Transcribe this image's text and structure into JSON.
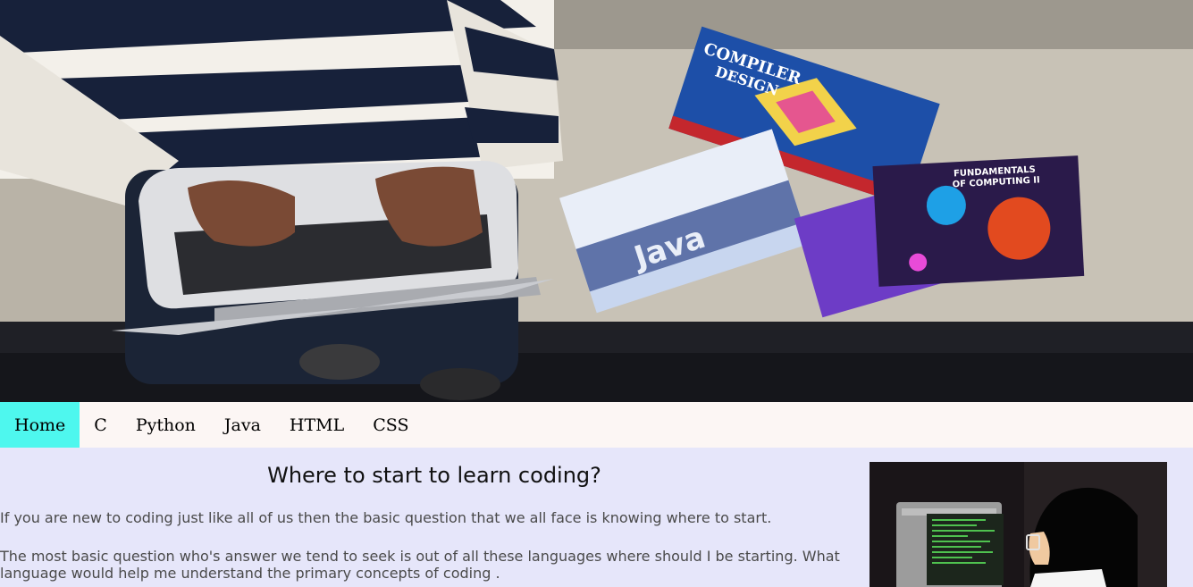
{
  "hero": {
    "image_alt": "person-coding-laptop-with-books",
    "book_labels": [
      "COMPILER DESIGN",
      "Java",
      "FUNDAMENTALS OF COMPUTING II"
    ]
  },
  "nav": {
    "items": [
      {
        "label": "Home",
        "active": true
      },
      {
        "label": "C"
      },
      {
        "label": "Python"
      },
      {
        "label": "Java"
      },
      {
        "label": "HTML"
      },
      {
        "label": "CSS"
      }
    ]
  },
  "main": {
    "title": "Where to start to learn coding?",
    "paragraphs": [
      "If you are new to coding just like all of us then the basic question that we all face is knowing where to start.",
      "The most basic question who's answer we tend to seek is out of all these languages where should I be starting. What language would help me understand the primary concepts of coding ."
    ]
  },
  "side_image": {
    "image_alt": "coder-at-terminal-illustration"
  },
  "colors": {
    "nav_active": "#4ef7ee",
    "nav_bg": "#fcf6f4",
    "page_bg": "#e6e6fa"
  }
}
